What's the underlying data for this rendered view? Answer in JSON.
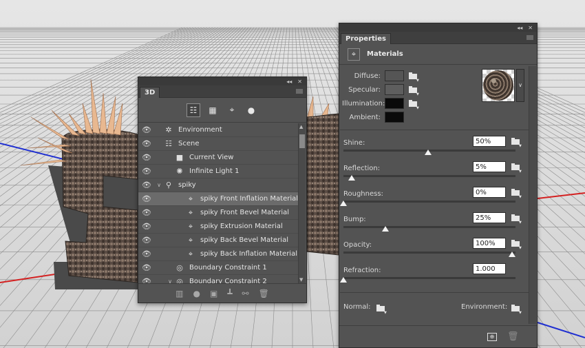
{
  "panel_3d": {
    "tab_label": "3D",
    "toolbar": [
      {
        "name": "scene-filter-icon",
        "glyph": "☷",
        "active": true
      },
      {
        "name": "mesh-filter-icon",
        "glyph": "▦",
        "active": false
      },
      {
        "name": "material-filter-icon",
        "glyph": "⌖",
        "active": false
      },
      {
        "name": "light-filter-icon",
        "glyph": "●",
        "active": false
      }
    ],
    "layers": [
      {
        "label": "Environment",
        "icon": "environment-icon",
        "glyph": "✲",
        "indent": 0,
        "arrow": "",
        "visible": true,
        "selected": false
      },
      {
        "label": "Scene",
        "icon": "scene-icon",
        "glyph": "☷",
        "indent": 0,
        "arrow": "",
        "visible": true,
        "selected": false
      },
      {
        "label": "Current View",
        "icon": "camera-icon",
        "glyph": "■",
        "indent": 1,
        "arrow": "",
        "visible": true,
        "selected": false
      },
      {
        "label": "Infinite Light 1",
        "icon": "light-icon",
        "glyph": "✺",
        "indent": 1,
        "arrow": "",
        "visible": true,
        "selected": false
      },
      {
        "label": "spiky",
        "icon": "mesh-icon",
        "glyph": "⚲",
        "indent": 0,
        "arrow": "∨",
        "visible": true,
        "selected": false
      },
      {
        "label": "spiky Front Inflation Material",
        "icon": "material-icon",
        "glyph": "⌖",
        "indent": 2,
        "arrow": "",
        "visible": true,
        "selected": true
      },
      {
        "label": "spiky Front Bevel Material",
        "icon": "material-icon",
        "glyph": "⌖",
        "indent": 2,
        "arrow": "",
        "visible": true,
        "selected": false
      },
      {
        "label": "spiky Extrusion Material",
        "icon": "material-icon",
        "glyph": "⌖",
        "indent": 2,
        "arrow": "",
        "visible": true,
        "selected": false
      },
      {
        "label": "spiky Back Bevel Material",
        "icon": "material-icon",
        "glyph": "⌖",
        "indent": 2,
        "arrow": "",
        "visible": true,
        "selected": false
      },
      {
        "label": "spiky Back Inflation Material",
        "icon": "material-icon",
        "glyph": "⌖",
        "indent": 2,
        "arrow": "",
        "visible": true,
        "selected": false
      },
      {
        "label": "Boundary Constraint 1",
        "icon": "constraint-icon",
        "glyph": "◎",
        "indent": 1,
        "arrow": "",
        "visible": true,
        "selected": false
      },
      {
        "label": "Boundary Constraint 2",
        "icon": "constraint-icon",
        "glyph": "◎",
        "indent": 1,
        "arrow": "∨",
        "visible": true,
        "selected": false
      }
    ],
    "footer_icons": [
      {
        "name": "render-icon",
        "glyph": "▥"
      },
      {
        "name": "add-light-icon",
        "glyph": "●"
      },
      {
        "name": "add-mesh-icon",
        "glyph": "▣"
      },
      {
        "name": "place-on-ground-icon",
        "glyph": "┻"
      },
      {
        "name": "split-icon",
        "glyph": "⚯"
      },
      {
        "name": "delete-icon",
        "glyph": "🗑"
      }
    ]
  },
  "properties": {
    "tab_label": "Properties",
    "section_title": "Materials",
    "colors": [
      {
        "label": "Diffuse:",
        "swatch": "#555555"
      },
      {
        "label": "Specular:",
        "swatch": "#5e5e5e"
      },
      {
        "label": "Illumination:",
        "swatch": "#0a0a0a"
      },
      {
        "label": "Ambient:",
        "swatch": "#0a0a0a"
      }
    ],
    "sliders": [
      {
        "label": "Shine:",
        "value": "50%",
        "level": 0.5
      },
      {
        "label": "Reflection:",
        "value": "5%",
        "level": 0.05
      },
      {
        "label": "Roughness:",
        "value": "0%",
        "level": 0
      },
      {
        "label": "Bump:",
        "value": "25%",
        "level": 0.25
      },
      {
        "label": "Opacity:",
        "value": "100%",
        "level": 1
      },
      {
        "label": "Refraction:",
        "value": "1.000",
        "level": 0
      }
    ],
    "normal_label": "Normal:",
    "environment_label": "Environment:"
  },
  "colors": {
    "panel_bg": "#535353",
    "axis_red": "#d42020",
    "axis_blue": "#1f2fd1",
    "spike": "#e8b890"
  }
}
